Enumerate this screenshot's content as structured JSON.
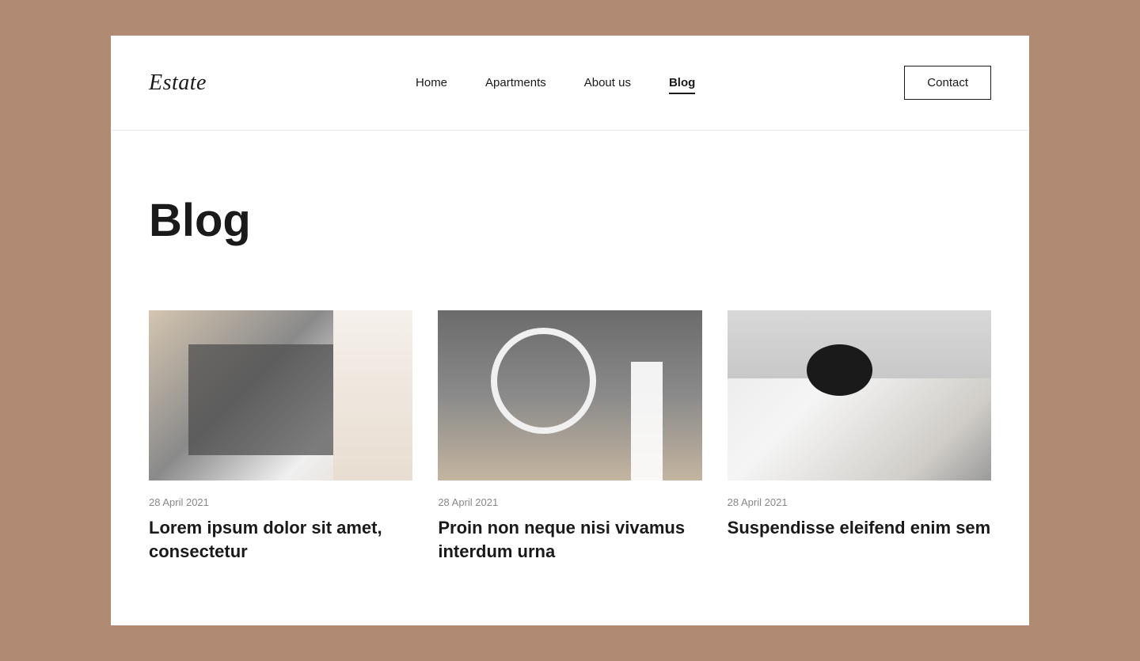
{
  "site": {
    "logo": "Estate",
    "background_color": "#b08a72"
  },
  "header": {
    "nav": [
      {
        "label": "Home",
        "active": false
      },
      {
        "label": "Apartments",
        "active": false
      },
      {
        "label": "About us",
        "active": false
      },
      {
        "label": "Blog",
        "active": true
      }
    ],
    "contact_label": "Contact"
  },
  "main": {
    "page_title": "Blog",
    "posts": [
      {
        "date": "28 April 2021",
        "title": "Lorem ipsum dolor sit amet, consectetur",
        "image_alt": "Modern apartment balcony with brick walls"
      },
      {
        "date": "28 April 2021",
        "title": "Proin non neque nisi vivamus interdum urna",
        "image_alt": "Modern bathroom with round mirror"
      },
      {
        "date": "28 April 2021",
        "title": "Suspendisse eleifend enim sem",
        "image_alt": "Modern kitchen with marble backsplash"
      }
    ]
  }
}
